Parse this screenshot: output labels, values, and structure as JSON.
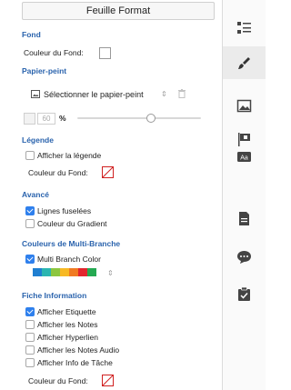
{
  "panel_title": "Feuille Format",
  "fond": {
    "heading": "Fond",
    "color_label": "Couleur du Fond:"
  },
  "papier_peint": {
    "heading": "Papier-peint",
    "select_label": "Sélectionner le papier-peint",
    "opacity_value": "60",
    "percent_sign": "%",
    "opacity_level": 0.6
  },
  "legende": {
    "heading": "Légende",
    "show_label": "Afficher la légende",
    "show_checked": false,
    "color_label": "Couleur du Fond:"
  },
  "avance": {
    "heading": "Avancé",
    "items": [
      {
        "label": "Lignes fuselées",
        "checked": true
      },
      {
        "label": "Couleur du Gradient",
        "checked": false
      }
    ]
  },
  "multi_branche": {
    "heading": "Couleurs de Multi-Branche",
    "label": "Multi Branch Color",
    "checked": true,
    "palette": [
      "#1f7fd1",
      "#2bb5b0",
      "#8cc63f",
      "#f7b924",
      "#f07a22",
      "#e3262e",
      "#25a952"
    ]
  },
  "fiche": {
    "heading": "Fiche Information",
    "items": [
      {
        "label": "Afficher Etiquette",
        "checked": true
      },
      {
        "label": "Afficher les Notes",
        "checked": false
      },
      {
        "label": "Afficher Hyperlien",
        "checked": false
      },
      {
        "label": "Afficher les Notes Audio",
        "checked": false
      },
      {
        "label": "Afficher Info de Tâche",
        "checked": false
      }
    ],
    "color_label": "Couleur du Fond:"
  },
  "sidebar_icons": [
    "format-icon",
    "paint-brush-icon",
    "image-icon",
    "flag-icon",
    "text-style-icon",
    "notes-icon",
    "comment-icon",
    "task-icon"
  ],
  "colors": {
    "accent_blue": "#2a63ad",
    "checkbox_blue": "#2f80ed",
    "swatch_red": "#d02020"
  }
}
